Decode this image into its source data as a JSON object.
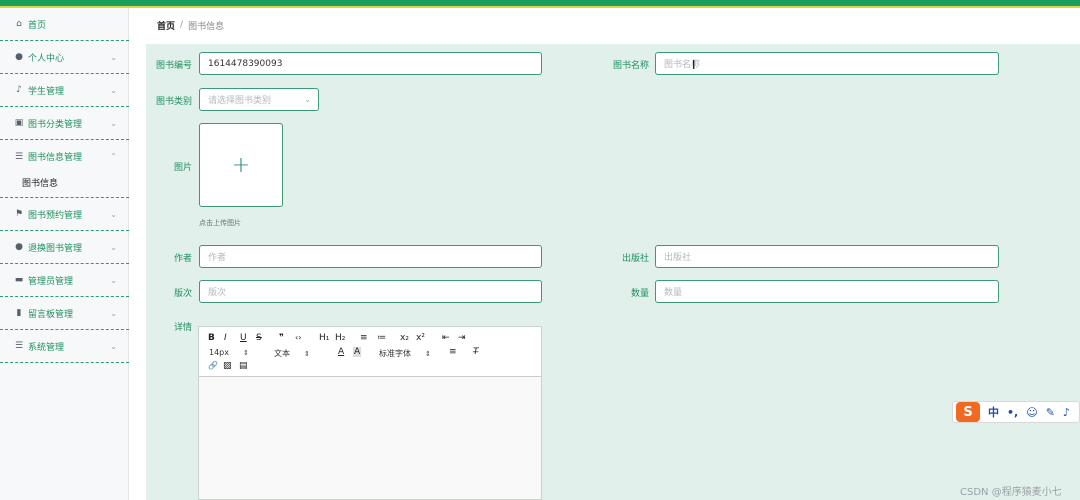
{
  "sidebar": {
    "items": [
      {
        "label": "首页",
        "icon": "home-icon",
        "glyph": "⌂",
        "chevron": ""
      },
      {
        "label": "个人中心",
        "icon": "user-icon",
        "glyph": "●",
        "chevron": "⌄"
      },
      {
        "label": "学生管理",
        "icon": "microphone-icon",
        "glyph": "♪",
        "chevron": "⌄"
      },
      {
        "label": "图书分类管理",
        "icon": "chart-icon",
        "glyph": "▣",
        "chevron": "⌄"
      },
      {
        "label": "图书信息管理",
        "icon": "list-icon",
        "glyph": "☰",
        "chevron": "⌃"
      },
      {
        "label": "图书预约管理",
        "icon": "flag-icon",
        "glyph": "⚑",
        "chevron": "⌄"
      },
      {
        "label": "退换图书管理",
        "icon": "user-icon",
        "glyph": "●",
        "chevron": "⌄"
      },
      {
        "label": "管理员管理",
        "icon": "monitor-icon",
        "glyph": "▬",
        "chevron": "⌄"
      },
      {
        "label": "留言板管理",
        "icon": "bar-chart-icon",
        "glyph": "▮",
        "chevron": "⌄"
      },
      {
        "label": "系统管理",
        "icon": "menu-icon",
        "glyph": "☰",
        "chevron": "⌄"
      }
    ],
    "sub_item": "图书信息"
  },
  "breadcrumb": {
    "home": "首页",
    "separator": "/",
    "current": "图书信息"
  },
  "form": {
    "book_no": {
      "label": "图书编号",
      "value": "1614478390093"
    },
    "book_name": {
      "label": "图书名称",
      "placeholder": "图书名称"
    },
    "category": {
      "label": "图书类别",
      "placeholder": "请选择图书类别"
    },
    "image": {
      "label": "图片",
      "plus": "+",
      "hint": "点击上传图片"
    },
    "author": {
      "label": "作者",
      "placeholder": "作者"
    },
    "publisher": {
      "label": "出版社",
      "placeholder": "出版社"
    },
    "edition": {
      "label": "版次",
      "placeholder": "版次"
    },
    "quantity": {
      "label": "数量",
      "placeholder": "数量"
    },
    "details": {
      "label": "详情"
    }
  },
  "editor": {
    "row1": [
      "B",
      "I",
      "U",
      "S",
      "❞",
      "‹›",
      "H₁",
      "H₂",
      "≡",
      "≔",
      "x₂",
      "x²",
      "⇤",
      "⇥"
    ],
    "font_size": "14px",
    "text_type": "文本",
    "font_family": "标准字体",
    "row3": [
      "🔗",
      "▨",
      "▤"
    ]
  },
  "ime": {
    "logo": "S",
    "items": [
      "中",
      "•,",
      "☺",
      "✎",
      "♪"
    ]
  },
  "watermark": "CSDN @程序猿麦小七",
  "colors": {
    "primary": "#1a9e5c",
    "accent_text": "#1e8f5e",
    "panel_bg": "#e1f0eb"
  }
}
